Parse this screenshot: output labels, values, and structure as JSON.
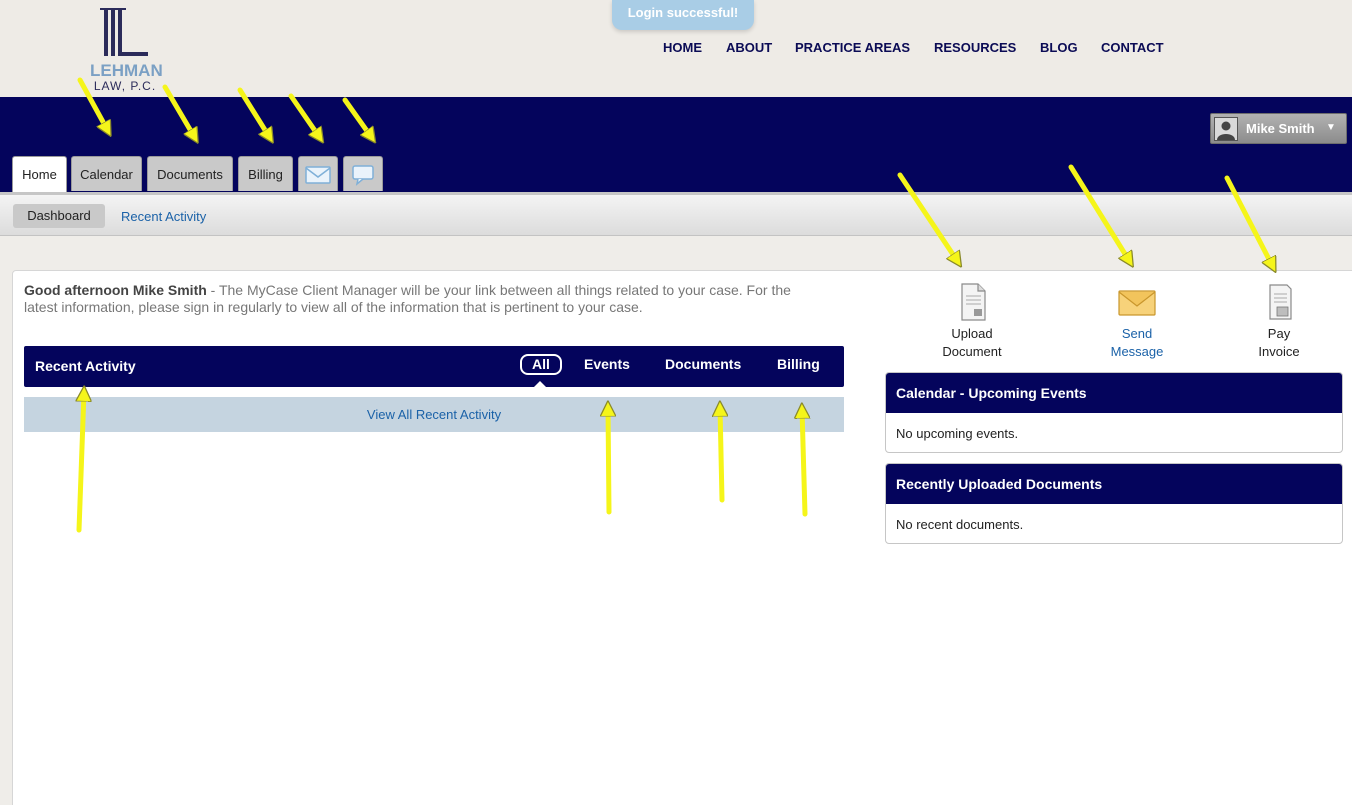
{
  "site": {
    "logo_name": "LEHMAN",
    "logo_sub": "LAW, P.C.",
    "toast": "Login successful!",
    "nav": [
      "HOME",
      "ABOUT",
      "PRACTICE AREAS",
      "RESOURCES",
      "BLOG",
      "CONTACT"
    ]
  },
  "app": {
    "user_name": "Mike Smith",
    "tabs": {
      "home": "Home",
      "calendar": "Calendar",
      "documents": "Documents",
      "billing": "Billing",
      "messages_icon": "envelope-icon",
      "comments_icon": "speech-bubble-icon"
    },
    "subnav": {
      "dashboard": "Dashboard",
      "recent_activity": "Recent Activity"
    }
  },
  "greeting": {
    "salutation": "Good afternoon Mike Smith",
    "message": " - The MyCase Client Manager will be your link between all things related to your case. For the latest information, please sign in regularly to view all of the information that is pertinent to your case."
  },
  "recent_activity": {
    "title": "Recent Activity",
    "filters": {
      "all": "All",
      "events": "Events",
      "documents": "Documents",
      "billing": "Billing"
    },
    "view_all": "View All Recent Activity"
  },
  "quick_actions": {
    "upload": {
      "line1": "Upload",
      "line2": "Document",
      "icon": "document-icon"
    },
    "message": {
      "line1": "Send",
      "line2": "Message",
      "icon": "envelope-icon"
    },
    "invoice": {
      "line1": "Pay",
      "line2": "Invoice",
      "icon": "invoice-icon"
    }
  },
  "panels": {
    "calendar": {
      "title": "Calendar - Upcoming Events",
      "empty": "No upcoming events."
    },
    "documents": {
      "title": "Recently Uploaded Documents",
      "empty": "No recent documents."
    }
  },
  "colors": {
    "navy": "#04045c",
    "link": "#1b62a8",
    "annotation_arrow": "#f5f51a"
  }
}
